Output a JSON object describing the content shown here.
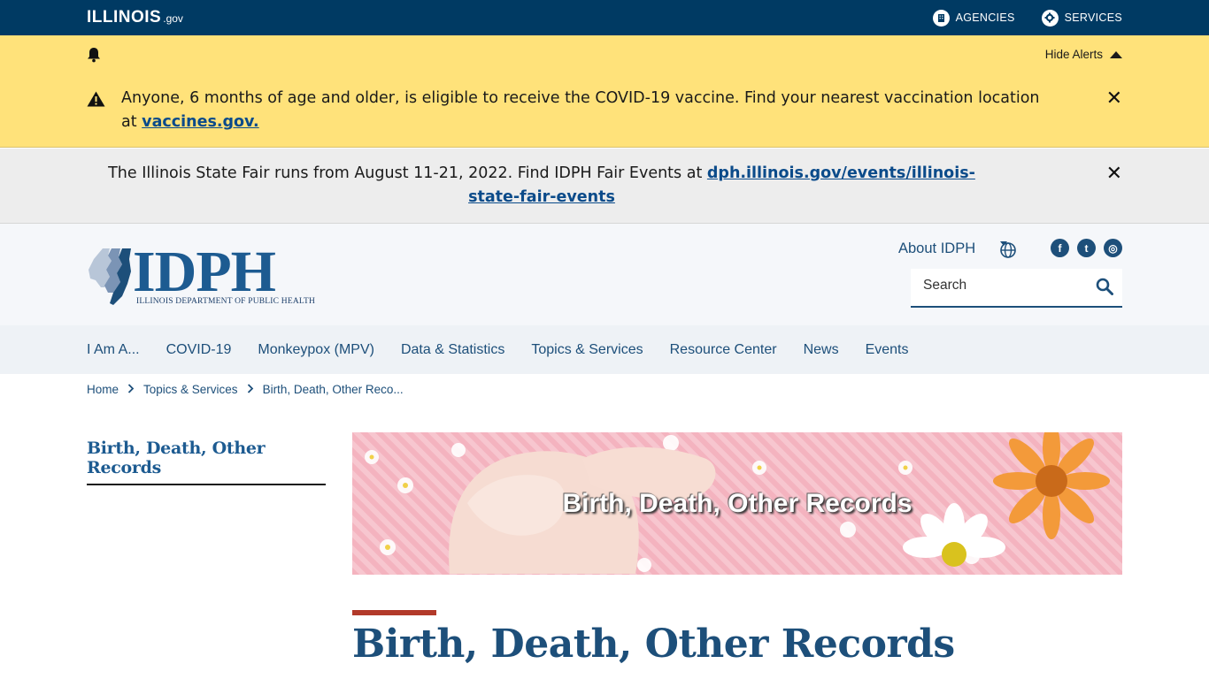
{
  "topbar": {
    "logo_word": "ILLINOIS",
    "logo_gov": ".gov",
    "links": [
      {
        "label": "AGENCIES",
        "icon": "building-icon"
      },
      {
        "label": "SERVICES",
        "icon": "gear-icon"
      }
    ]
  },
  "alerts": {
    "hide_label": "Hide Alerts",
    "covid_text": "Anyone, 6 months of age and older, is eligible to receive the COVID-19 vaccine. Find your nearest vaccination location at ",
    "covid_link": "vaccines.gov.",
    "fair_text": "The Illinois State Fair runs from August 11-21, 2022. Find IDPH Fair Events at ",
    "fair_link": "dph.illinois.gov/events/illinois-state-fair-events",
    "close_glyph": "✕"
  },
  "header": {
    "logo_word": "IDPH",
    "logo_sub": "ILLINOIS DEPARTMENT OF PUBLIC HEALTH",
    "about_label": "About IDPH",
    "socials": [
      {
        "name": "facebook-icon",
        "glyph": "f"
      },
      {
        "name": "twitter-icon",
        "glyph": "t"
      },
      {
        "name": "instagram-icon",
        "glyph": "◎"
      }
    ],
    "search_placeholder": "Search"
  },
  "nav": {
    "items": [
      "I Am A...",
      "COVID-19",
      "Monkeypox (MPV)",
      "Data & Statistics",
      "Topics & Services",
      "Resource Center",
      "News",
      "Events"
    ]
  },
  "breadcrumb": {
    "items": [
      "Home",
      "Topics & Services",
      "Birth, Death, Other Reco..."
    ],
    "sep": "›"
  },
  "sidebar": {
    "title": "Birth, Death, Other Records"
  },
  "banner": {
    "text": "Birth, Death, Other Records"
  },
  "page": {
    "title": "Birth, Death, Other Records"
  },
  "colors": {
    "topbar": "#003a63",
    "alert_yellow": "#ffe27a",
    "alert_gray": "#ededed",
    "brand_blue": "#1d5b91",
    "accent_red": "#b23a2a"
  }
}
